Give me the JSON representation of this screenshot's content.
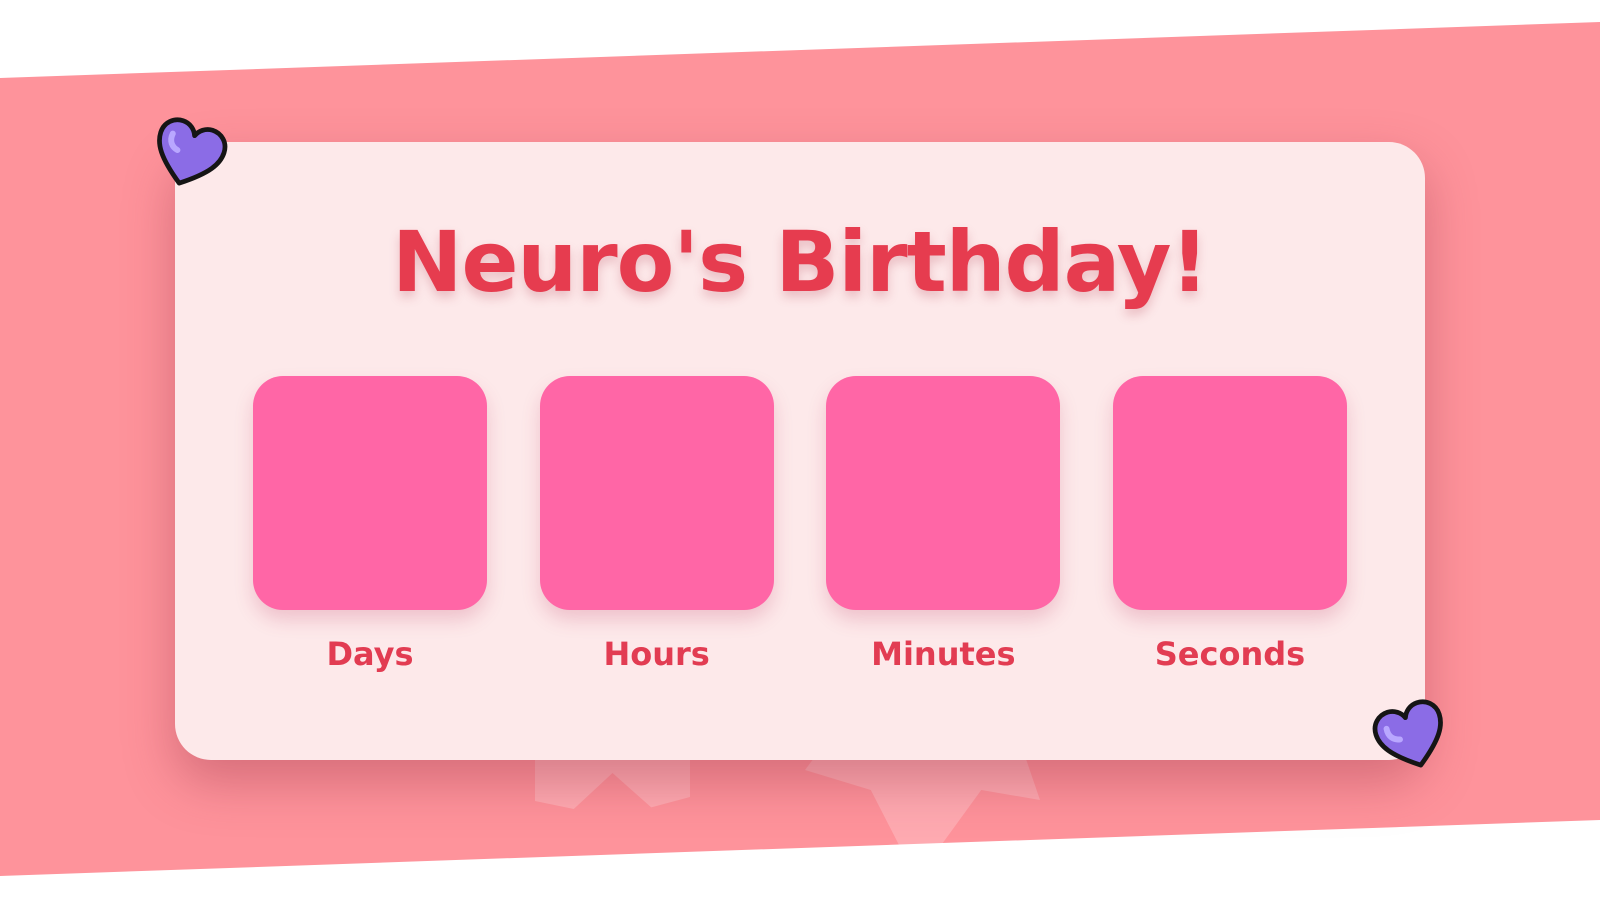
{
  "page": {
    "title": "Neuro's Birthday!"
  },
  "countdown": {
    "units": [
      {
        "label": "Days",
        "value": ""
      },
      {
        "label": "Hours",
        "value": ""
      },
      {
        "label": "Minutes",
        "value": ""
      },
      {
        "label": "Seconds",
        "value": ""
      }
    ]
  },
  "decorations": {
    "icons": [
      "heart-icon",
      "heart-icon"
    ]
  },
  "colors": {
    "background_band": "#fe939b",
    "card": "#fde9ea",
    "title": "#e63c4f",
    "box": "#ff66a6",
    "heart": "#8b6ce6"
  }
}
